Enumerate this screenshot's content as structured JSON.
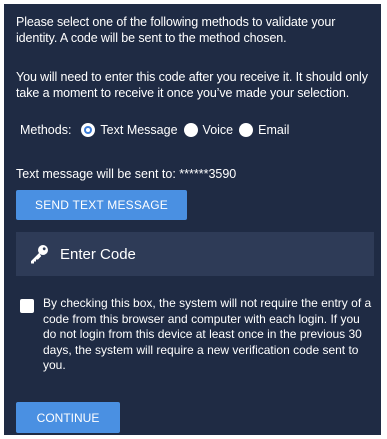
{
  "intro": {
    "text": "Please select one of the following methods to validate your identity. A code will be sent to the method chosen."
  },
  "instructions": {
    "text": "You will need to enter this code after you receive it. It should only take a moment to receive it once you’ve made your selection."
  },
  "methods": {
    "label": "Methods:",
    "options": [
      {
        "label": "Text Message",
        "selected": true
      },
      {
        "label": "Voice",
        "selected": false
      },
      {
        "label": "Email",
        "selected": false
      }
    ]
  },
  "send": {
    "info": "Text message will be sent to: ******3590",
    "button_label": "SEND TEXT MESSAGE"
  },
  "code": {
    "placeholder": "Enter Code",
    "icon": "key-icon"
  },
  "remember": {
    "checked": false,
    "text": "By checking this box, the system will not require the entry of a code from this browser and computer with each login. If you do not login from this device at least once in the previous 30 days, the system will require a new verification code sent to you."
  },
  "continue": {
    "button_label": "CONTINUE"
  },
  "colors": {
    "panel_bg": "#1f2b44",
    "field_bg": "#2e3b57",
    "button_bg": "#4a90e2",
    "text": "#ffffff"
  }
}
